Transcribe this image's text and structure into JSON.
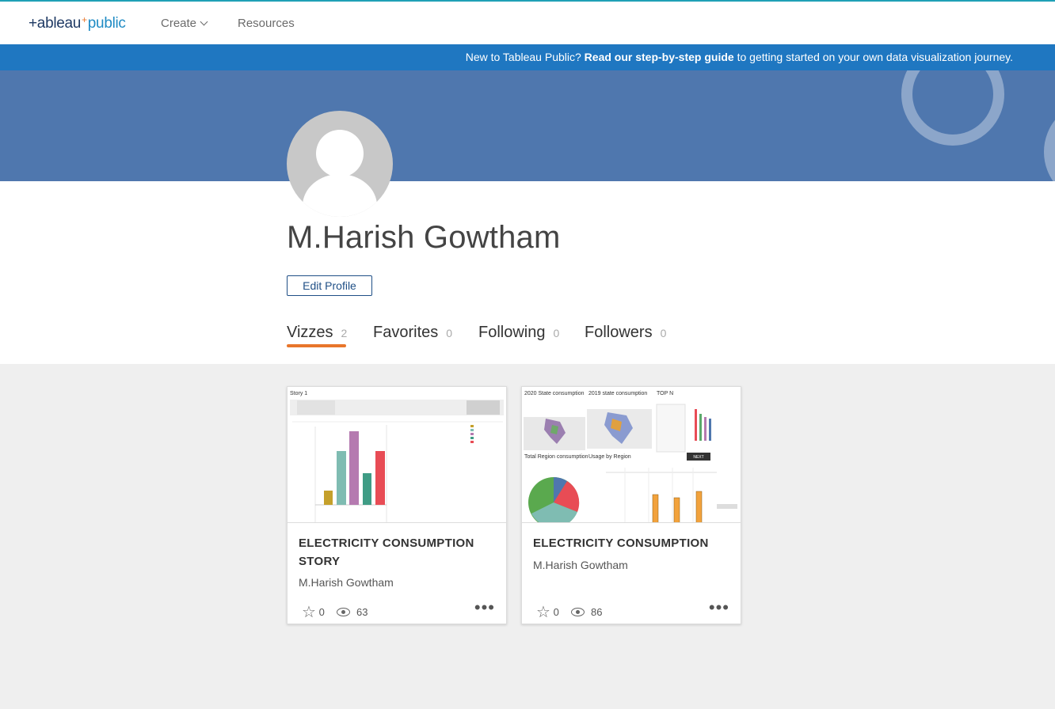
{
  "nav": {
    "logo_part1": "+ableau",
    "logo_plus": "+",
    "logo_part2": "public",
    "create_label": "Create",
    "resources_label": "Resources"
  },
  "banner": {
    "prefix": "New to Tableau Public?",
    "link": "Read our step-by-step guide",
    "suffix": "to getting started on your own data visualization journey."
  },
  "profile": {
    "name": "M.Harish Gowtham",
    "edit_label": "Edit Profile"
  },
  "tabs": [
    {
      "label": "Vizzes",
      "count": "2"
    },
    {
      "label": "Favorites",
      "count": "0"
    },
    {
      "label": "Following",
      "count": "0"
    },
    {
      "label": "Followers",
      "count": "0"
    }
  ],
  "cards": [
    {
      "title": "ELECTRICITY CONSUMPTION STORY",
      "author": "M.Harish Gowtham",
      "favorites": "0",
      "views": "63",
      "thumb_label": "Story 1"
    },
    {
      "title": "ELECTRICITY CONSUMPTION",
      "author": "M.Harish Gowtham",
      "favorites": "0",
      "views": "86",
      "thumb_labels": [
        "2020 State consumption",
        "2019 state consumption",
        "TOP N",
        "Total Region consumption",
        "Usage by Region",
        "NEXT"
      ]
    }
  ],
  "colors": {
    "banner": "#1f77c1",
    "hero": "#4f77ae",
    "accent": "#e8762b",
    "edit_border": "#1f4f86"
  }
}
